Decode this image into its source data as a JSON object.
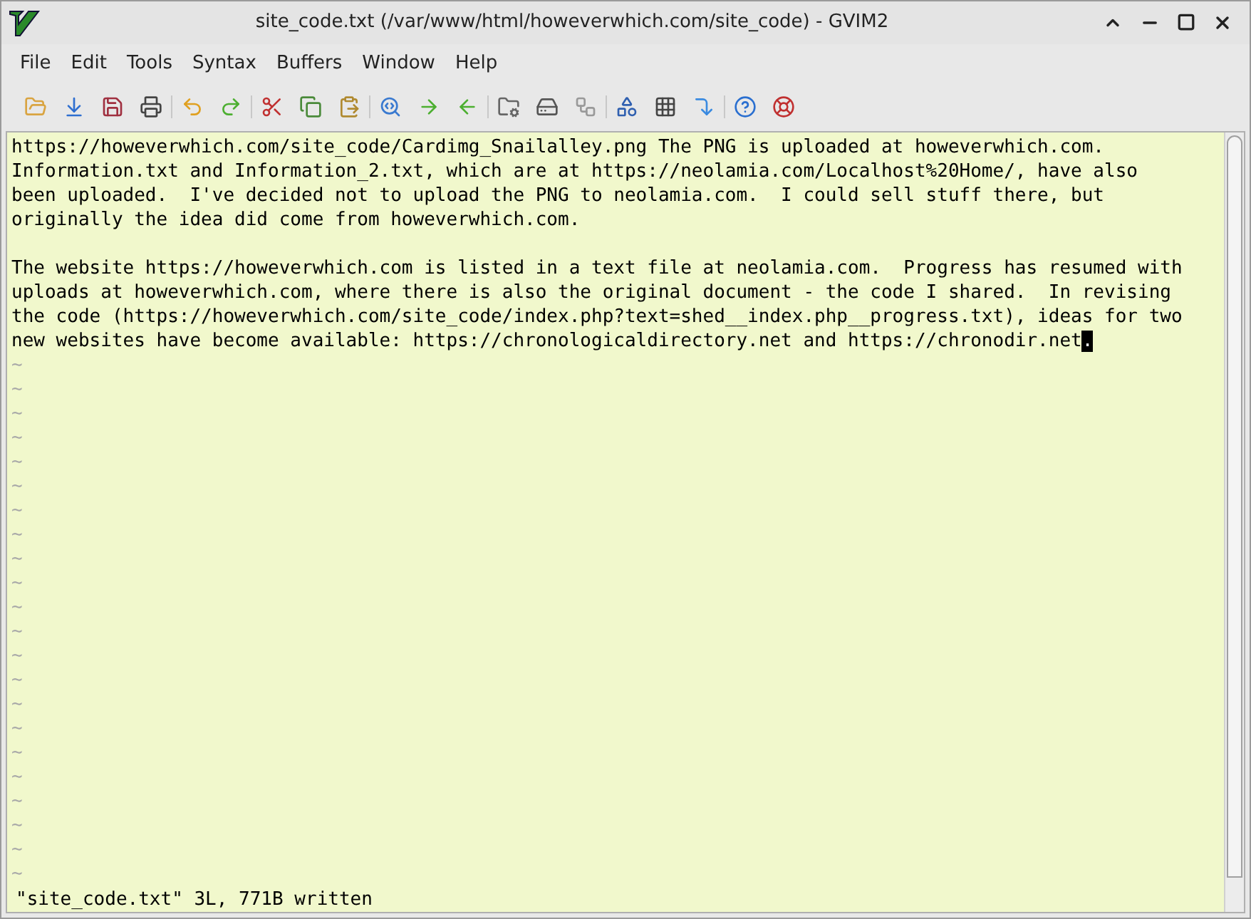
{
  "window": {
    "title": "site_code.txt (/var/www/html/howeverwhich.com/site_code) - GVIM2"
  },
  "menu": [
    "File",
    "Edit",
    "Tools",
    "Syntax",
    "Buffers",
    "Window",
    "Help"
  ],
  "editor": {
    "paragraphs": [
      [
        "https://howeverwhich.com/site_code/Cardimg_Snailalley.png The PNG is uploaded at howeverwhich.com.",
        "Information.txt and Information_2.txt, which are at https://neolamia.com/Localhost%20Home/, have also",
        "been uploaded.  I've decided not to upload the PNG to neolamia.com.  I could sell stuff there, but",
        "originally the idea did come from howeverwhich.com."
      ],
      [
        "The website https://howeverwhich.com is listed in a text file at neolamia.com.  Progress has resumed with",
        "uploads at howeverwhich.com, where there is also the original document - the code I shared.  In revising",
        "the code (https://howeverwhich.com/site_code/index.php?text=shed__index.php__progress.txt), ideas for two",
        "new websites have become available: https://chronologicaldirectory.net and https://chronodir.net"
      ]
    ],
    "cursor": ".",
    "empty_markers": [
      "~",
      "~",
      "~",
      "~",
      "~",
      "~",
      "~",
      "~",
      "~",
      "~",
      "~",
      "~",
      "~",
      "~",
      "~",
      "~",
      "~",
      "~",
      "~",
      "~",
      "~",
      "~"
    ]
  },
  "status_bar": {
    "message": "\"site_code.txt\" 3L, 771B written"
  }
}
